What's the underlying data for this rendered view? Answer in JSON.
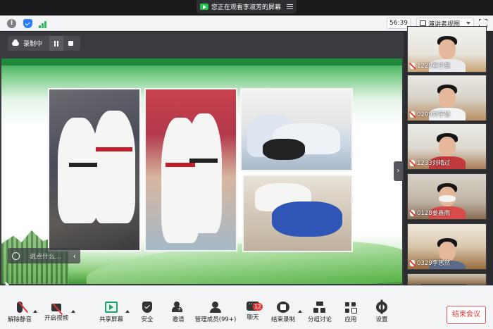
{
  "share_banner": {
    "text": "您正在观看李淑芳的屏幕"
  },
  "info_bar": {
    "timer": "56:39",
    "view_mode": "演讲者视图"
  },
  "recording": {
    "label": "录制中"
  },
  "chat_box": {
    "placeholder": "说点什么..."
  },
  "participants": [
    {
      "name": "1229黄子墨"
    },
    {
      "name": "0209刘宇楚"
    },
    {
      "name": "1233刘晴过"
    },
    {
      "name": "0128姜鑫雨"
    },
    {
      "name": "0329李思然"
    }
  ],
  "toolbar": {
    "unmute": "解除静音",
    "start_video": "开启视频",
    "share_screen": "共享屏幕",
    "security": "安全",
    "invite": "邀请",
    "manage_members": "管理成员(99+)",
    "chat": "聊天",
    "chat_badge": "12",
    "end_recording": "结束录制",
    "breakout": "分组讨论",
    "apps": "应用",
    "settings": "设置",
    "end_meeting": "结束会议"
  },
  "colors": {
    "accent_green": "#27c250",
    "end_red": "#e53935",
    "slide_green": "#2ea24a"
  }
}
